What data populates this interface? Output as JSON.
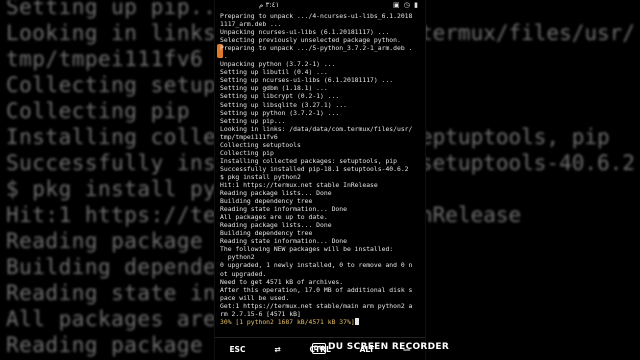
{
  "background": {
    "left_lines": [
      "Setting up pip...",
      "Looking in links:",
      "tmp/tmpei111fv6",
      "Collecting setupt",
      "Collecting pip",
      "Installing collec",
      "Successfully instal",
      "$ pkg install pyt",
      "Hit:1 https://ter",
      "Reading package l",
      "Building dependen",
      "Reading state inf",
      "All packages are",
      "Reading package l"
    ],
    "right_lines": [
      "",
      "termux/files/usr/",
      "",
      "",
      "",
      "eptuptools, pip",
      "setuptools-40.6.2",
      "",
      "nRelease",
      "",
      "",
      "",
      "",
      ""
    ]
  },
  "status_bar": {
    "time": "٣:٤١ م",
    "right_icons": "▣ ◷ ▮"
  },
  "terminal": {
    "lines": [
      "Preparing to unpack .../4-ncurses-ui-libs_6.1.2018",
      "1117_arm.deb ...",
      "Unpacking ncurses-ui-libs (6.1.20181117) ...",
      "Selecting previously unselected package python.",
      "Preparing to unpack .../5-python_3.7.2-1_arm.deb .",
      "..",
      "Unpacking python (3.7.2-1) ...",
      "Setting up libutil (0.4) ...",
      "Setting up ncurses-ui-libs (6.1.20181117) ...",
      "Setting up gdbm (1.18.1) ...",
      "Setting up libcrypt (0.2-1) ...",
      "Setting up libsqlite (3.27.1) ...",
      "Setting up python (3.7.2-1) ...",
      "Setting up pip...",
      "Looking in links: /data/data/com.termux/files/usr/",
      "tmp/tmpei111fv6",
      "Collecting setuptools",
      "Collecting pip",
      "Installing collected packages: setuptools, pip",
      "Successfully installed pip-18.1 setuptools-40.6.2",
      "$ pkg install python2",
      "Hit:1 https://termux.net stable InRelease",
      "Reading package lists... Done",
      "Building dependency tree",
      "Reading state information... Done",
      "All packages are up to date.",
      "Reading package lists... Done",
      "Building dependency tree",
      "Reading state information... Done",
      "The following NEW packages will be installed:",
      "  python2",
      "0 upgraded, 1 newly installed, 0 to remove and 0 n",
      "ot upgraded.",
      "Need to get 4571 kB of archives.",
      "After this operation, 17.0 MB of additional disk s",
      "pace will be used.",
      "Get:1 https://termux.net stable/main arm python2 a",
      "rm 2.7.15-6 [4571 kB]"
    ],
    "progress_line": "30% [1 python2 1687 kB/4571 kB 37%]"
  },
  "extra_keys": [
    "ESC",
    "⇄",
    "CTRL",
    "ALT",
    "—"
  ],
  "watermark": {
    "text": "DU SCREEN RECORDER",
    "logo": "DU"
  }
}
